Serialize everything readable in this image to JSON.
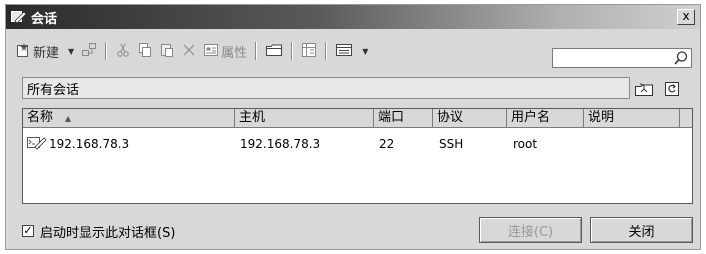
{
  "window": {
    "title": "会话",
    "close_label": "x"
  },
  "toolbar": {
    "new_label": "新建",
    "properties_label": "属性"
  },
  "search": {
    "value": ""
  },
  "folder": {
    "path_label": "所有会话"
  },
  "table": {
    "columns": [
      "名称",
      "主机",
      "端口",
      "协议",
      "用户名",
      "说明"
    ],
    "rows": [
      {
        "name": "192.168.78.3",
        "host": "192.168.78.3",
        "port": "22",
        "protocol": "SSH",
        "username": "root",
        "description": ""
      }
    ]
  },
  "footer": {
    "startup_checkbox_label": "启动时显示此对话框(S)",
    "startup_checked": true,
    "connect_label": "连接(C)",
    "close_label": "关闭"
  }
}
